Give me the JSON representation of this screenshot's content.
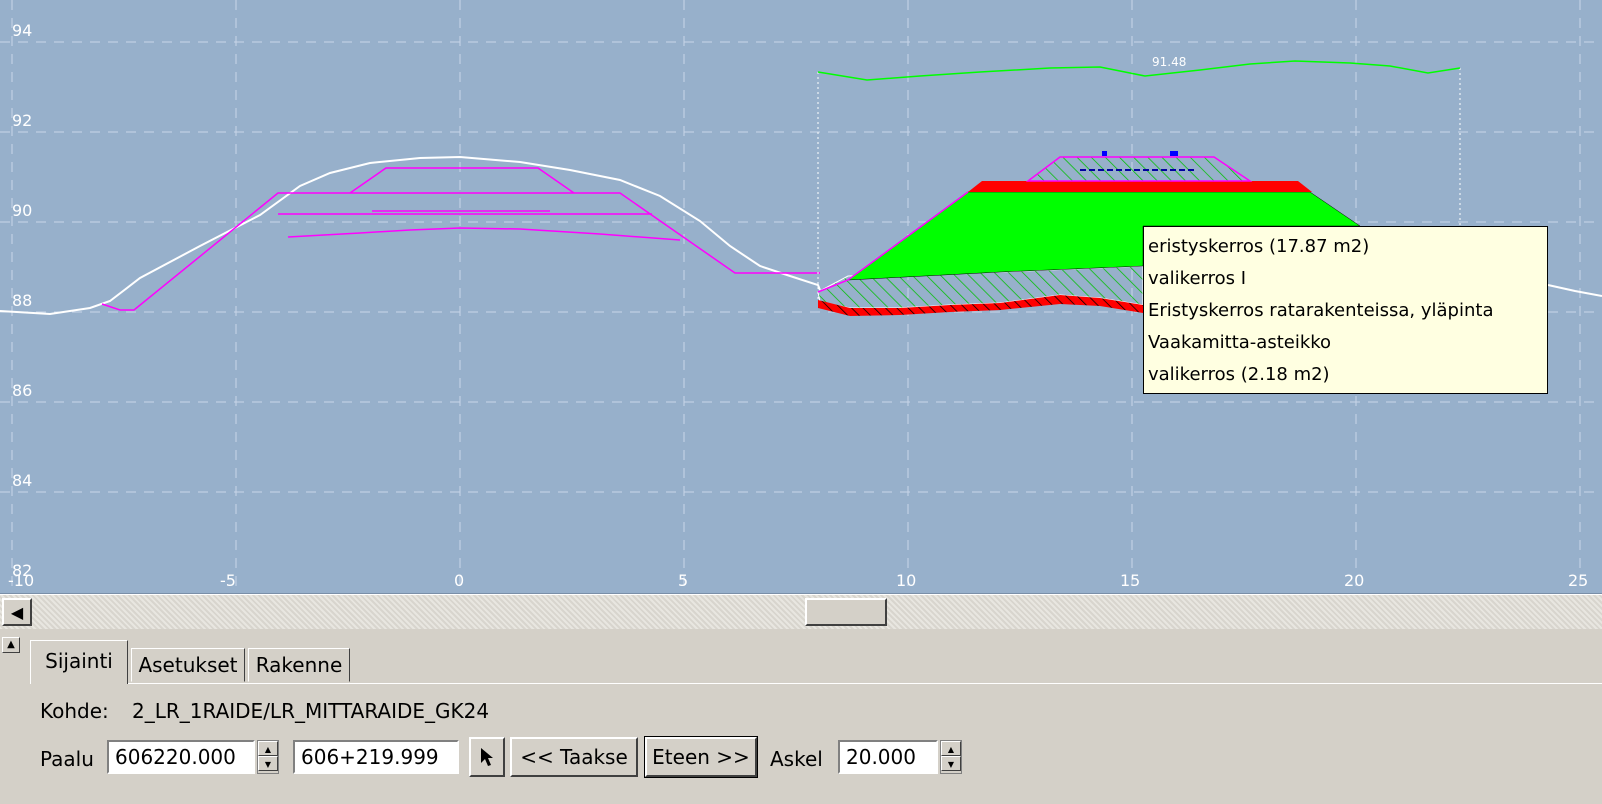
{
  "plot": {
    "y_tick_labels": [
      "94",
      "92",
      "90",
      "88",
      "86",
      "84",
      "82"
    ],
    "x_tick_labels": [
      "-10",
      "-5",
      "0",
      "5",
      "10",
      "15",
      "20",
      "25"
    ],
    "surface_label": "91.48"
  },
  "tooltip": {
    "lines": [
      "eristyskerros (17.87 m2)",
      "valikerros I",
      "Eristyskerros ratarakenteissa, yläpinta",
      "Vaakamitta-asteikko",
      "valikerros (2.18 m2)"
    ]
  },
  "scrollbar": {
    "left_arrow": "◀"
  },
  "tabs": [
    {
      "label": "Sijainti",
      "active": true
    },
    {
      "label": "Asetukset",
      "active": false
    },
    {
      "label": "Rakenne",
      "active": false
    }
  ],
  "panel": {
    "collapse_icon": "▲",
    "kohde_label": "Kohde:",
    "kohde_value": "2_LR_1RAIDE/LR_MITTARAIDE_GK24",
    "paalu_label": "Paalu",
    "paalu_value": "606220.000",
    "paalu_formatted": "606+219.999",
    "pick_icon": "cursor-arrow-icon",
    "back_button": "<< Taakse",
    "forward_button": "Eteen >>",
    "askel_label": "Askel",
    "askel_value": "20.000"
  },
  "colors": {
    "plot_background": "#97b0cb",
    "gridline": "#c8d6e8",
    "ground_line": "#ffffff",
    "design_line": "#ff00ff",
    "fill_green": "#00ff00",
    "fill_red": "#ff0000",
    "surface_line": "#00ff00",
    "tooltip_background": "#ffffe1"
  }
}
